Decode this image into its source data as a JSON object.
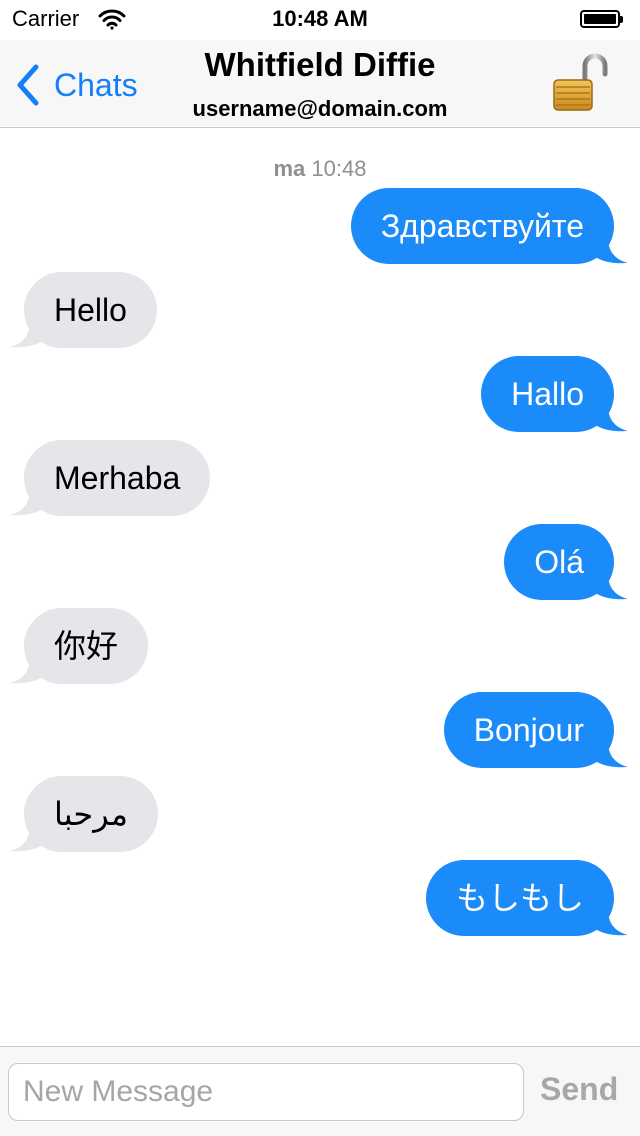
{
  "status_bar": {
    "carrier": "Carrier",
    "time": "10:48 AM",
    "battery_level": 1.0
  },
  "nav": {
    "back_label": "Chats",
    "title": "Whitfield Diffie",
    "subtitle": "username@domain.com",
    "lock_icon": "open-padlock-icon"
  },
  "thread": {
    "timestamp_day": "ma",
    "timestamp_time": "10:48",
    "messages": [
      {
        "direction": "outgoing",
        "text": "Здравствуйте"
      },
      {
        "direction": "incoming",
        "text": "Hello"
      },
      {
        "direction": "outgoing",
        "text": "Hallo"
      },
      {
        "direction": "incoming",
        "text": "Merhaba"
      },
      {
        "direction": "outgoing",
        "text": "Olá"
      },
      {
        "direction": "incoming",
        "text": "你好"
      },
      {
        "direction": "outgoing",
        "text": "Bonjour"
      },
      {
        "direction": "incoming",
        "text": "مرحبا"
      },
      {
        "direction": "outgoing",
        "text": "もしもし"
      }
    ]
  },
  "composer": {
    "placeholder": "New Message",
    "value": "",
    "send_label": "Send"
  },
  "colors": {
    "accent": "#147efb",
    "outgoing_bubble": "#1a8bf9",
    "incoming_bubble": "#e5e5ea",
    "muted": "#8e8e93"
  }
}
